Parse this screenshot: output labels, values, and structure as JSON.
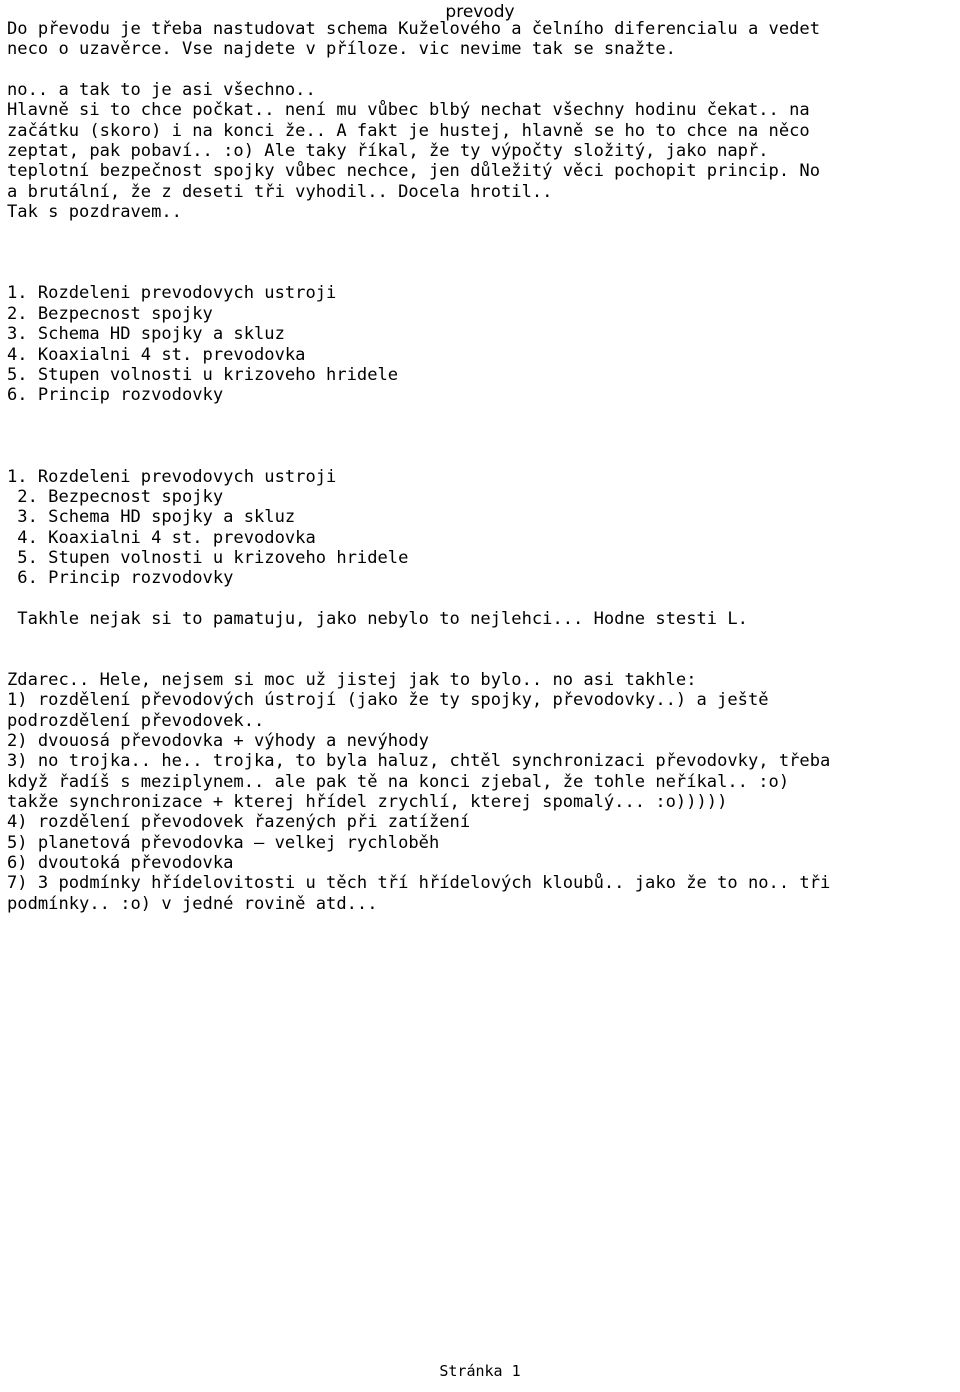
{
  "document": {
    "header_title": "prevody",
    "footer_text": "Stránka 1",
    "page_number": "1",
    "colors": {
      "background": "#ffffff",
      "text": "#000000"
    },
    "lines": [
      {
        "id": "l01",
        "text": "Do převodu je třeba nastudovat schema Kuželového a čelního diferencialu a vedet"
      },
      {
        "id": "l02",
        "text": "neco o uzavěrce. Vse najdete v příloze. vic nevime tak se snažte."
      },
      {
        "id": "l03",
        "text": ""
      },
      {
        "id": "l04",
        "text": "no.. a tak to je asi všechno.."
      },
      {
        "id": "l05",
        "text": "Hlavně si to chce počkat.. není mu vůbec blbý nechat všechny hodinu čekat.. na"
      },
      {
        "id": "l06",
        "text": "začátku (skoro) i na konci že.. A fakt je hustej, hlavně se ho to chce na něco"
      },
      {
        "id": "l07",
        "text": "zeptat, pak pobaví.. :o) Ale taky říkal, že ty výpočty složitý, jako např."
      },
      {
        "id": "l08",
        "text": "teplotní bezpečnost spojky vůbec nechce, jen důležitý věci pochopit princip. No"
      },
      {
        "id": "l09",
        "text": "a brutální, že z deseti tři vyhodil.. Docela hrotil.."
      },
      {
        "id": "l10",
        "text": "Tak s pozdravem.."
      },
      {
        "id": "l11",
        "text": ""
      },
      {
        "id": "l12",
        "text": ""
      },
      {
        "id": "l13",
        "text": ""
      },
      {
        "id": "l14",
        "text": "1. Rozdeleni prevodovych ustroji"
      },
      {
        "id": "l15",
        "text": "2. Bezpecnost spojky"
      },
      {
        "id": "l16",
        "text": "3. Schema HD spojky a skluz"
      },
      {
        "id": "l17",
        "text": "4. Koaxialni 4 st. prevodovka"
      },
      {
        "id": "l18",
        "text": "5. Stupen volnosti u krizoveho hridele"
      },
      {
        "id": "l19",
        "text": "6. Princip rozvodovky"
      },
      {
        "id": "l20",
        "text": ""
      },
      {
        "id": "l21",
        "text": ""
      },
      {
        "id": "l22",
        "text": ""
      },
      {
        "id": "l23",
        "text": "1. Rozdeleni prevodovych ustroji"
      },
      {
        "id": "l24",
        "text": " 2. Bezpecnost spojky"
      },
      {
        "id": "l25",
        "text": " 3. Schema HD spojky a skluz"
      },
      {
        "id": "l26",
        "text": " 4. Koaxialni 4 st. prevodovka"
      },
      {
        "id": "l27",
        "text": " 5. Stupen volnosti u krizoveho hridele"
      },
      {
        "id": "l28",
        "text": " 6. Princip rozvodovky"
      },
      {
        "id": "l29",
        "text": ""
      },
      {
        "id": "l30",
        "text": " Takhle nejak si to pamatuju, jako nebylo to nejlehci... Hodne stesti L."
      },
      {
        "id": "l31",
        "text": ""
      },
      {
        "id": "l32",
        "text": ""
      },
      {
        "id": "l33",
        "text": "Zdarec.. Hele, nejsem si moc už jistej jak to bylo.. no asi takhle:"
      },
      {
        "id": "l34",
        "text": "1) rozdělení převodových ústrojí (jako že ty spojky, převodovky..) a ještě"
      },
      {
        "id": "l35",
        "text": "podrozdělení převodovek.."
      },
      {
        "id": "l36",
        "text": "2) dvouosá převodovka + výhody a nevýhody"
      },
      {
        "id": "l37",
        "text": "3) no trojka.. he.. trojka, to byla haluz, chtěl synchronizaci převodovky, třeba"
      },
      {
        "id": "l38",
        "text": "když řadíš s meziplynem.. ale pak tě na konci zjebal, že tohle neříkal.. :o)"
      },
      {
        "id": "l39",
        "text": "takže synchronizace + kterej hřídel zrychlí, kterej spomalý... :o)))))"
      },
      {
        "id": "l40",
        "text": "4) rozdělení převodovek řazených při zatížení"
      },
      {
        "id": "l41",
        "text": "5) planetová převodovka – velkej rychloběh"
      },
      {
        "id": "l42",
        "text": "6) dvoutoká převodovka"
      },
      {
        "id": "l43",
        "text": "7) 3 podmínky hřídelovitosti u těch tří hřídelových kloubů.. jako že to no.. tři"
      },
      {
        "id": "l44",
        "text": "podmínky.. :o) v jedné rovině atd..."
      }
    ]
  }
}
